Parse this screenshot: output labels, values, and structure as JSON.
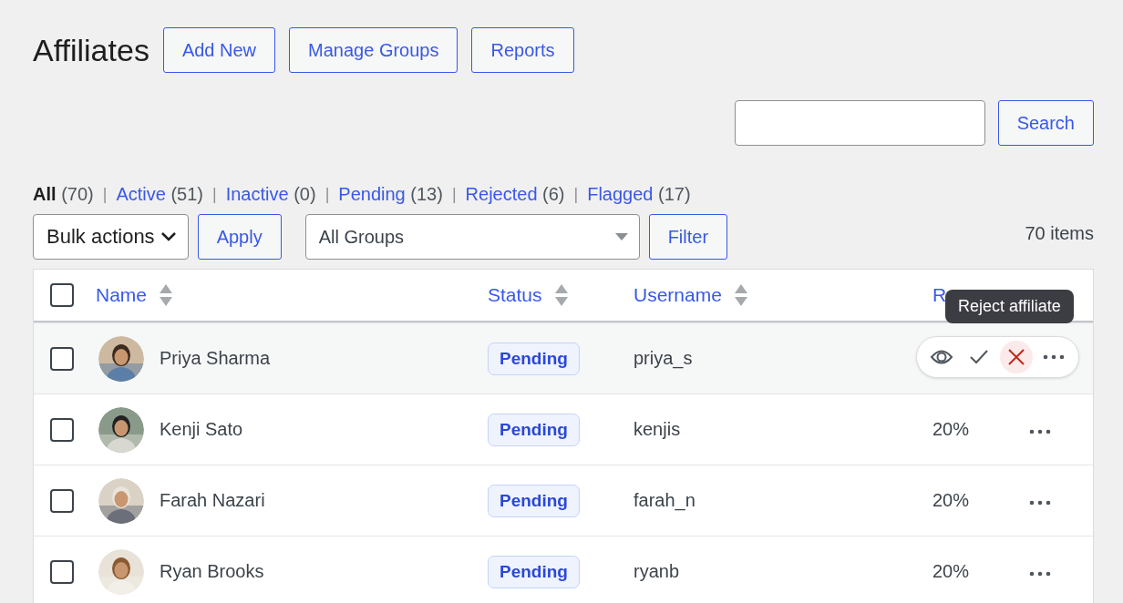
{
  "page": {
    "title": "Affiliates",
    "header_buttons": [
      "Add New",
      "Manage Groups",
      "Reports"
    ]
  },
  "search": {
    "button": "Search"
  },
  "views": [
    {
      "label": "All",
      "count": "(70)",
      "selected": true
    },
    {
      "separator": "|",
      "label": "Active",
      "count": "(51)",
      "selected": false
    },
    {
      "separator": "|",
      "label": "Inactive",
      "count": "(0)",
      "selected": false
    },
    {
      "separator": "|",
      "label": "Pending",
      "count": "(13)",
      "selected": false
    },
    {
      "separator": "|",
      "label": "Rejected",
      "count": "(6)",
      "selected": false
    },
    {
      "separator": "|",
      "label": "Flagged",
      "count": "(17)",
      "selected": false
    }
  ],
  "toolbar": {
    "bulk_actions": "Bulk actions",
    "apply": "Apply",
    "group_filter": "All Groups",
    "filter": "Filter",
    "item_count": "70 items"
  },
  "table": {
    "select_all": {
      "checked": false
    },
    "columns": [
      {
        "label": "Name",
        "sortable": true
      },
      {
        "label": "Status",
        "sortable": true
      },
      {
        "label": "Username",
        "sortable": true
      },
      {
        "label": "R"
      }
    ],
    "tooltip": "Reject affiliate",
    "rows": [
      {
        "name": "Priya Sharma",
        "status": "Pending",
        "username": "priya_s",
        "checked": false,
        "hovered": true
      },
      {
        "name": "Kenji Sato",
        "status": "Pending",
        "username": "kenjis",
        "rate": "20%",
        "checked": false,
        "hovered": false
      },
      {
        "name": "Farah Nazari",
        "status": "Pending",
        "username": "farah_n",
        "rate": "20%",
        "checked": false,
        "hovered": false
      },
      {
        "name": "Ryan Brooks",
        "status": "Pending",
        "username": "ryanb",
        "rate": "20%",
        "checked": false,
        "hovered": false
      }
    ]
  }
}
